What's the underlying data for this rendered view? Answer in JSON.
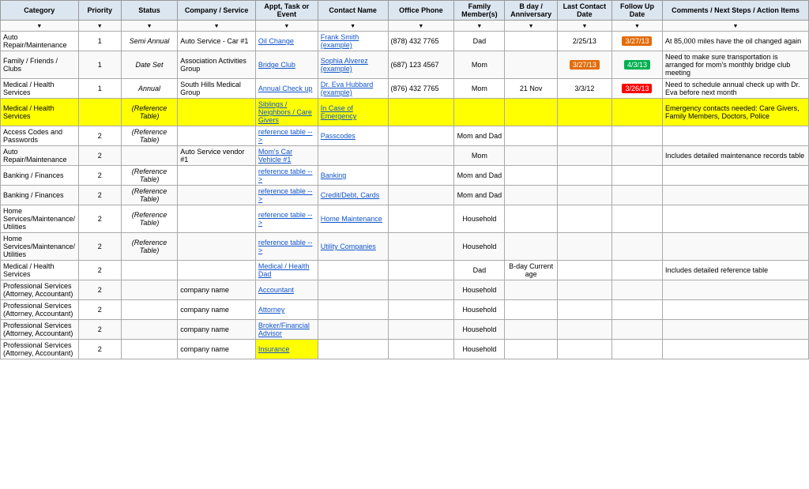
{
  "header": {
    "columns": [
      "Category",
      "Priority",
      "Status",
      "Company / Service",
      "Appt, Task or Event",
      "Contact Name",
      "Office Phone",
      "Family Member(s)",
      "B day / Anniversary",
      "Last Contact Date",
      "Follow Up Date",
      "Comments / Next Steps / Action Items"
    ]
  },
  "rows": [
    {
      "category": "Auto Repair/Maintenance",
      "priority": "1",
      "status": "Semi Annual",
      "company": "Auto Service - Car #1",
      "appt": "Oil Change",
      "appt_link": true,
      "contact": "Frank Smith (example)",
      "contact_link": true,
      "phone": "(878) 432 7765",
      "family": "Dad",
      "bday": "",
      "lastcontact": "2/25/13",
      "followup": "3/27/13",
      "followup_badge": "orange",
      "comments": "At 85,000 miles have the oil changed again"
    },
    {
      "category": "Family / Friends / Clubs",
      "priority": "1",
      "status": "Date Set",
      "company": "Association Activities Group",
      "appt": "Bridge Club",
      "appt_link": true,
      "contact": "Sophia Alverez (example)",
      "contact_link": true,
      "phone": "(687) 123 4567",
      "family": "Mom",
      "bday": "",
      "lastcontact": "3/27/13",
      "lastcontact_badge": "orange",
      "followup": "4/3/13",
      "followup_badge": "green",
      "comments": "Need to make sure transportation is arranged for mom's monthly bridge club meeting"
    },
    {
      "category": "Medical / Health Services",
      "priority": "1",
      "status": "Annual",
      "company": "South Hills Medical Group",
      "appt": "Annual Check up",
      "appt_link": true,
      "contact": "Dr. Eva Hubbard (example)",
      "contact_link": true,
      "phone": "(876) 432 7765",
      "family": "Mom",
      "bday": "21 Nov",
      "lastcontact": "3/3/12",
      "followup": "3/26/13",
      "followup_badge": "red",
      "comments": "Need to schedule annual check up with Dr. Eva before next month"
    },
    {
      "category": "Medical / Health Services",
      "priority": "",
      "status": "(Reference Table)",
      "company": "",
      "appt": "Siblings / Neighbors / Care Givers",
      "appt_link": true,
      "contact": "In Case of Emergency",
      "contact_link": true,
      "phone": "",
      "family": "",
      "bday": "",
      "lastcontact": "",
      "followup": "",
      "comments": "Emergency contacts needed: Care Givers, Family Members, Doctors, Police",
      "row_yellow": true
    },
    {
      "category": "Access Codes and Passwords",
      "priority": "2",
      "status": "(Reference Table)",
      "company": "",
      "appt": "reference table -->",
      "appt_link": true,
      "contact": "Passcodes",
      "contact_link": true,
      "phone": "",
      "family": "Mom and Dad",
      "bday": "",
      "lastcontact": "",
      "followup": "",
      "comments": ""
    },
    {
      "category": "Auto Repair/Maintenance",
      "priority": "2",
      "status": "",
      "company": "Auto Service vendor #1",
      "appt": "Mom's Car Vehicle #1",
      "appt_link": true,
      "contact": "",
      "contact_link": false,
      "phone": "",
      "family": "Mom",
      "bday": "",
      "lastcontact": "",
      "followup": "",
      "comments": "Includes detailed maintenance records table"
    },
    {
      "category": "Banking / Finances",
      "priority": "2",
      "status": "(Reference Table)",
      "company": "",
      "appt": "reference table -->",
      "appt_link": true,
      "contact": "Banking",
      "contact_link": true,
      "phone": "",
      "family": "Mom and Dad",
      "bday": "",
      "lastcontact": "",
      "followup": "",
      "comments": ""
    },
    {
      "category": "Banking / Finances",
      "priority": "2",
      "status": "(Reference Table)",
      "company": "",
      "appt": "reference table -->",
      "appt_link": true,
      "contact": "Credit/Debt, Cards",
      "contact_link": true,
      "phone": "",
      "family": "Mom and Dad",
      "bday": "",
      "lastcontact": "",
      "followup": "",
      "comments": ""
    },
    {
      "category": "Home Services/Maintenance/Utilities",
      "priority": "2",
      "status": "(Reference Table)",
      "company": "",
      "appt": "reference table -->",
      "appt_link": true,
      "contact": "Home Maintenance",
      "contact_link": true,
      "phone": "",
      "family": "Household",
      "bday": "",
      "lastcontact": "",
      "followup": "",
      "comments": ""
    },
    {
      "category": "Home Services/Maintenance/Utilities",
      "priority": "2",
      "status": "(Reference Table)",
      "company": "",
      "appt": "reference table -->",
      "appt_link": true,
      "contact": "Utility Companies",
      "contact_link": true,
      "phone": "",
      "family": "Household",
      "bday": "",
      "lastcontact": "",
      "followup": "",
      "comments": ""
    },
    {
      "category": "Medical / Health Services",
      "priority": "2",
      "status": "",
      "company": "",
      "appt": "Medical / Health Dad",
      "appt_link": true,
      "contact": "",
      "contact_link": false,
      "phone": "",
      "family": "Dad",
      "bday": "B-day Current age",
      "lastcontact": "",
      "followup": "",
      "comments": "Includes detailed reference table"
    },
    {
      "category": "Professional Services (Attorney, Accountant)",
      "priority": "2",
      "status": "",
      "company": "company name",
      "appt": "Accountant",
      "appt_link": true,
      "contact": "",
      "contact_link": false,
      "phone": "",
      "family": "Household",
      "bday": "",
      "lastcontact": "",
      "followup": "",
      "comments": ""
    },
    {
      "category": "Professional Services (Attorney, Accountant)",
      "priority": "2",
      "status": "",
      "company": "company name",
      "appt": "Attorney",
      "appt_link": true,
      "contact": "",
      "contact_link": false,
      "phone": "",
      "family": "Household",
      "bday": "",
      "lastcontact": "",
      "followup": "",
      "comments": ""
    },
    {
      "category": "Professional Services (Attorney, Accountant)",
      "priority": "2",
      "status": "",
      "company": "company name",
      "appt": "Broker/Financial Advisor",
      "appt_link": true,
      "contact": "",
      "contact_link": false,
      "phone": "",
      "family": "Household",
      "bday": "",
      "lastcontact": "",
      "followup": "",
      "comments": ""
    },
    {
      "category": "Professional Services (Attorney, Accountant)",
      "priority": "2",
      "status": "",
      "company": "company name",
      "appt": "Insurance",
      "appt_link": true,
      "appt_yellow": true,
      "contact": "",
      "contact_link": false,
      "phone": "",
      "family": "Household",
      "bday": "",
      "lastcontact": "",
      "followup": "",
      "comments": ""
    }
  ]
}
